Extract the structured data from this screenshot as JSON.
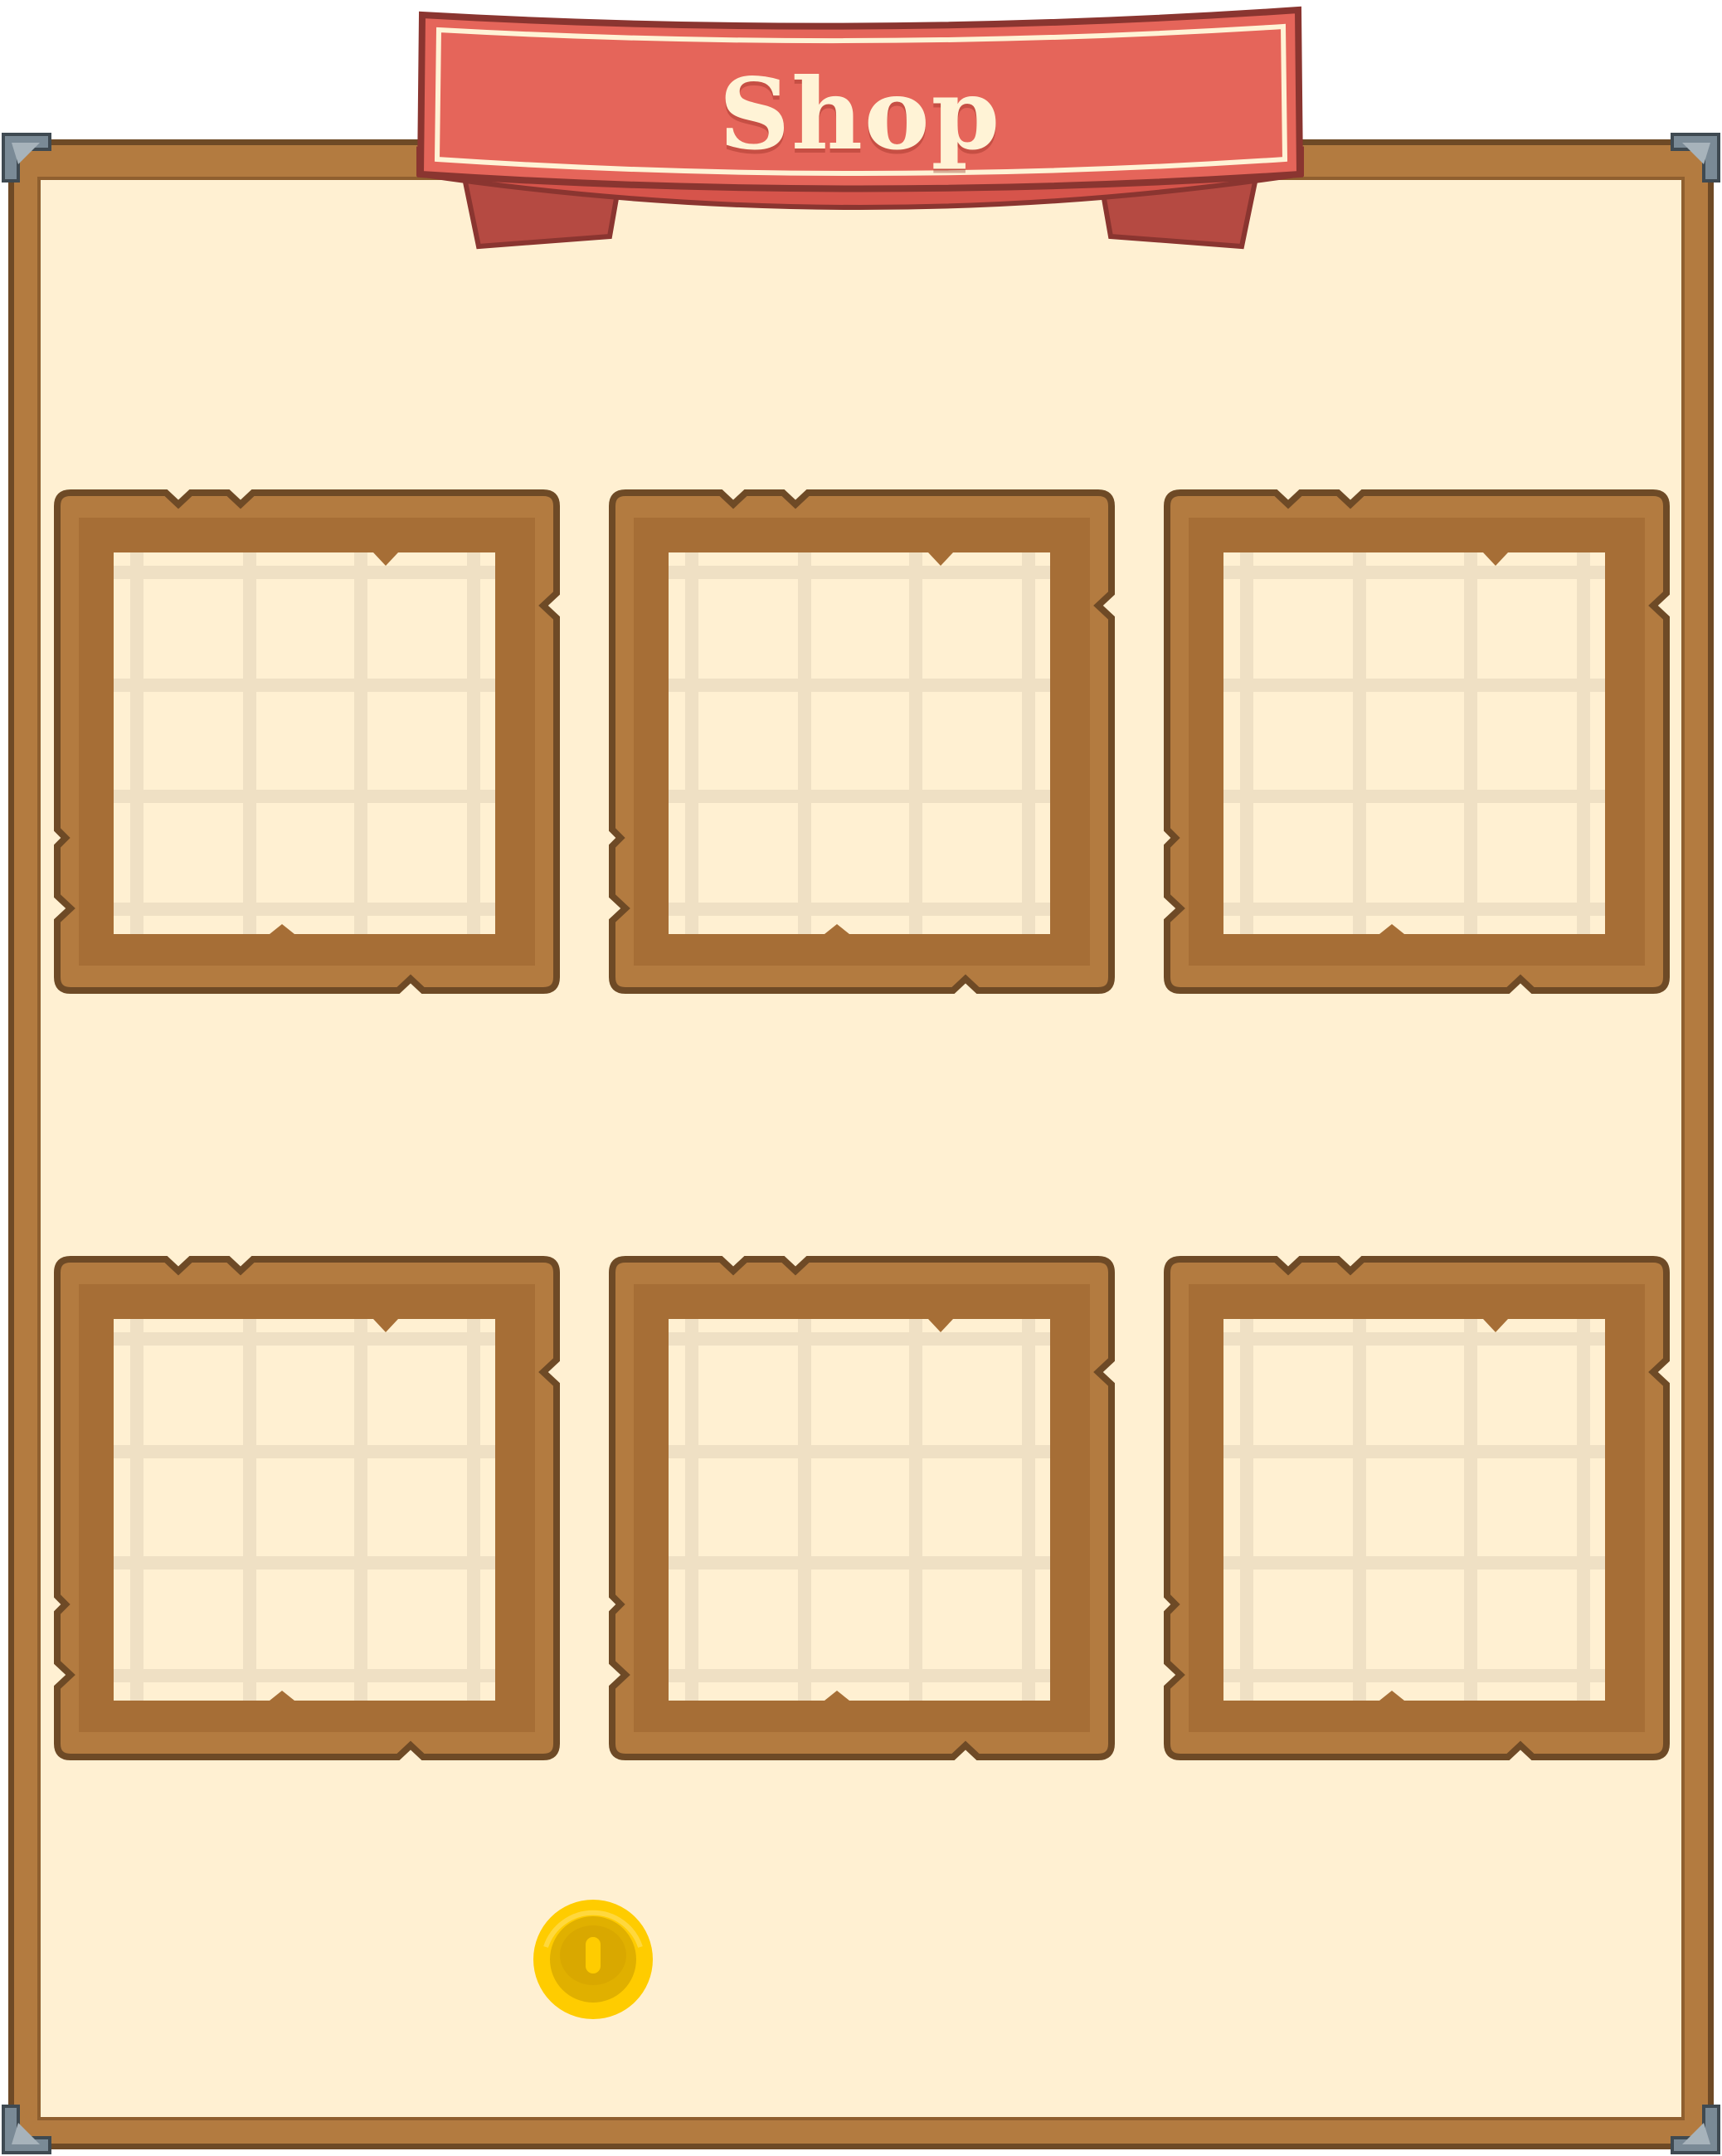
{
  "shop": {
    "title": "Shop",
    "slot_count": 6,
    "slots": [
      {
        "row": 1,
        "column": 1,
        "content": ""
      },
      {
        "row": 1,
        "column": 2,
        "content": ""
      },
      {
        "row": 1,
        "column": 3,
        "content": ""
      },
      {
        "row": 2,
        "column": 1,
        "content": ""
      },
      {
        "row": 2,
        "column": 2,
        "content": ""
      },
      {
        "row": 2,
        "column": 3,
        "content": ""
      }
    ],
    "currency_icon": "gold-coin-icon"
  },
  "colors": {
    "panel_wood": "#b37b40",
    "panel_outline": "#6e4a26",
    "parchment": "#fff0d2",
    "banner_red": "#e5655a",
    "banner_dark": "#b54a42",
    "banner_text": "#fff3d6",
    "slot_grid": "#efe0c4",
    "corner_metal": "#7a8a96",
    "coin_gold": "#ffcc00"
  }
}
